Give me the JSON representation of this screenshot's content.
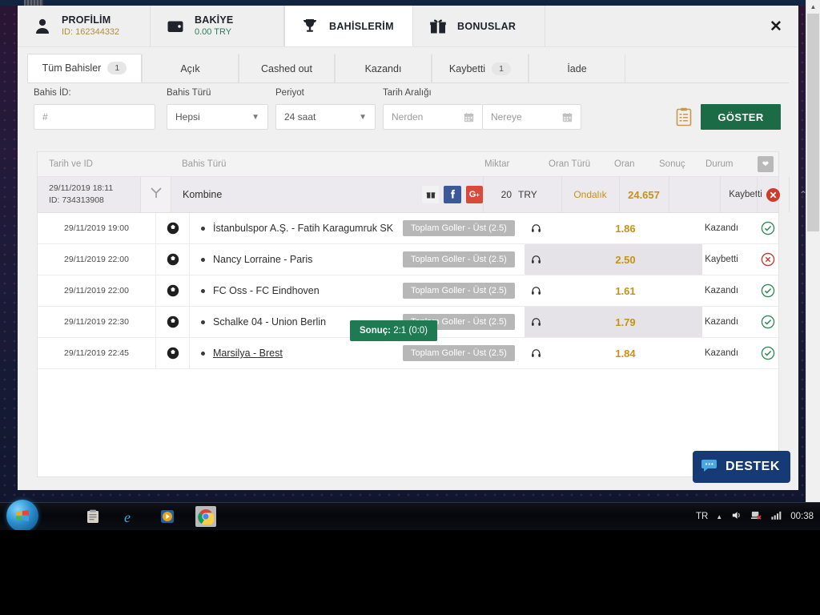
{
  "header": {
    "tabs": [
      {
        "id": "profilim",
        "icon": "user-icon",
        "title": "PROFİLİM",
        "sub": "ID: 162344332",
        "sub_style": "gold",
        "active": false
      },
      {
        "id": "bakiye",
        "icon": "wallet-icon",
        "title": "BAKİYE",
        "sub": "0.00 TRY",
        "sub_style": "green",
        "active": false
      },
      {
        "id": "bahislerim",
        "icon": "trophy-icon",
        "title": "BAHİSLERİM",
        "sub": "",
        "sub_style": "",
        "active": true
      },
      {
        "id": "bonuslar",
        "icon": "gift-icon",
        "title": "BONUSLAR",
        "sub": "",
        "sub_style": "",
        "active": false
      }
    ],
    "close_label": "✕"
  },
  "nav_tabs": [
    {
      "label": "Tüm Bahisler",
      "count": "1",
      "active": true
    },
    {
      "label": "Açık",
      "count": "",
      "active": false
    },
    {
      "label": "Cashed out",
      "count": "",
      "active": false
    },
    {
      "label": "Kazandı",
      "count": "",
      "active": false
    },
    {
      "label": "Kaybetti",
      "count": "1",
      "active": false
    },
    {
      "label": "İade",
      "count": "",
      "active": false
    }
  ],
  "filters": {
    "bet_id_label": "Bahis İD:",
    "bet_id_value": "#",
    "bet_type_label": "Bahis Türü",
    "bet_type_value": "Hepsi",
    "period_label": "Periyot",
    "period_value": "24 saat",
    "date_range_label": "Tarih Aralığı",
    "date_from_placeholder": "Nerden",
    "date_to_placeholder": "Nereye",
    "show_button": "GÖSTER"
  },
  "table": {
    "columns": {
      "date_id": "Tarih ve ID",
      "bet_type": "Bahis Türü",
      "amount": "Miktar",
      "odds_type": "Oran Türü",
      "odds": "Oran",
      "result": "Sonuç",
      "status": "Durum"
    },
    "combine": {
      "date": "29/11/2019 18:11",
      "id": "ID: 734313908",
      "type": "Kombine",
      "amount": "20",
      "currency": "TRY",
      "odds_type": "Ondalık",
      "odds": "24.657",
      "result": "",
      "status": "Kaybetti",
      "status_kind": "lost",
      "share_icons": [
        "gift-icon",
        "facebook-icon",
        "googleplus-icon"
      ]
    },
    "rows": [
      {
        "date": "29/11/2019 19:00",
        "sport": "football-icon",
        "match": "İstanbulspor A.Ş. - Fatih Karagumruk SK",
        "market": "Toplam Goller - Üst (2.5)",
        "odds": "1.86",
        "status": "Kazandı",
        "status_kind": "won",
        "highlight": false,
        "underline": false
      },
      {
        "date": "29/11/2019 22:00",
        "sport": "football-icon",
        "match": "Nancy Lorraine - Paris",
        "market": "Toplam Goller - Üst (2.5)",
        "odds": "2.50",
        "status": "Kaybetti",
        "status_kind": "lost",
        "highlight": true,
        "underline": false
      },
      {
        "date": "29/11/2019 22:00",
        "sport": "football-icon",
        "match": "FC Oss - FC Eindhoven",
        "market": "Toplam Goller - Üst (2.5)",
        "odds": "1.61",
        "status": "Kazandı",
        "status_kind": "won",
        "highlight": false,
        "underline": false
      },
      {
        "date": "29/11/2019 22:30",
        "sport": "football-icon",
        "match": "Schalke 04 - Union Berlin",
        "market": "Toplam Goller - Üst (2.5)",
        "odds": "1.79",
        "status": "Kazandı",
        "status_kind": "won",
        "highlight": true,
        "underline": false
      },
      {
        "date": "29/11/2019 22:45",
        "sport": "football-icon",
        "match": "Marsilya - Brest",
        "market": "Toplam Goller - Üst (2.5)",
        "odds": "1.84",
        "status": "Kazandı",
        "status_kind": "won",
        "highlight": false,
        "underline": true
      }
    ],
    "tooltip": {
      "label": "Sonuç:",
      "value": "2:1 (0:0)"
    }
  },
  "support_widget": {
    "label": "DESTEK",
    "icon": "chat-bubble-icon"
  },
  "taskbar": {
    "start_icon": "windows-start-icon",
    "items": [
      {
        "icon": "explorer-folder-icon",
        "active": false
      },
      {
        "icon": "internet-explorer-icon",
        "active": false
      },
      {
        "icon": "media-player-icon",
        "active": false
      },
      {
        "icon": "chrome-icon",
        "active": true
      }
    ],
    "tray": {
      "language": "TR",
      "show_hidden_icon": "chevron-up-icon",
      "volume_icon": "volume-icon",
      "network_icon": "network-error-icon",
      "signal_icon": "signal-bars-icon",
      "clock": "00:38"
    }
  }
}
